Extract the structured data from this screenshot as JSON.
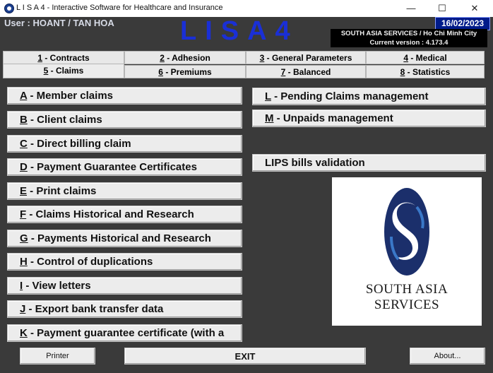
{
  "window": {
    "title": "L I S A 4 - Interactive Software for Healthcare and Insurance",
    "minimize": "—",
    "maximize": "☐",
    "close": "✕"
  },
  "header": {
    "user": "User : HOANT / TAN HOA",
    "logo": "LISA4",
    "date": "16/02/2023",
    "company": "SOUTH ASIA SERVICES / Ho Chi Minh City",
    "version": "Current version : 4.173.4"
  },
  "tabs": {
    "row1": [
      {
        "key": "1",
        "label": " - Contracts"
      },
      {
        "key": "2",
        "label": " - Adhesion"
      },
      {
        "key": "3",
        "label": " - General Parameters"
      },
      {
        "key": "4",
        "label": " - Medical"
      }
    ],
    "row2": [
      {
        "key": "5",
        "label": " - Claims"
      },
      {
        "key": "6",
        "label": " - Premiums"
      },
      {
        "key": "7",
        "label": " - Balanced"
      },
      {
        "key": "8",
        "label": " - Statistics"
      }
    ],
    "active": "5 - Claims"
  },
  "left_menu": [
    {
      "key": "A",
      "label": " - Member claims"
    },
    {
      "key": "B",
      "label": " - Client claims"
    },
    {
      "key": "C",
      "label": " - Direct billing claim"
    },
    {
      "key": "D",
      "label": " - Payment Guarantee Certificates"
    },
    {
      "key": "E",
      "label": " - Print claims"
    },
    {
      "key": "F",
      "label": " - Claims Historical and Research"
    },
    {
      "key": "G",
      "label": " - Payments Historical and Research"
    },
    {
      "key": "H",
      "label": " - Control of duplications"
    },
    {
      "key": "I",
      "label": " - View letters"
    },
    {
      "key": "J",
      "label": " - Export bank transfer data"
    },
    {
      "key": "K",
      "label": " - Payment guarantee certificate (with a"
    }
  ],
  "right_menu": [
    {
      "key": "L",
      "label": " -  Pending Claims management"
    },
    {
      "key": "M",
      "label": " - Unpaids management"
    }
  ],
  "lips_button": "LIPS bills validation",
  "brand_logo": {
    "caption": "SOUTH ASIA SERVICES",
    "colors": {
      "dark": "#1b2f6b",
      "light": "#3a78c8"
    }
  },
  "footer": {
    "printer_label": "Printer",
    "exit_label": "EXIT",
    "about_label": "About..."
  },
  "colors": {
    "background": "#3a3a3a",
    "logo_text": "#1a2fd6",
    "date_bg": "#001b8a",
    "button_bg": "#ececec"
  }
}
